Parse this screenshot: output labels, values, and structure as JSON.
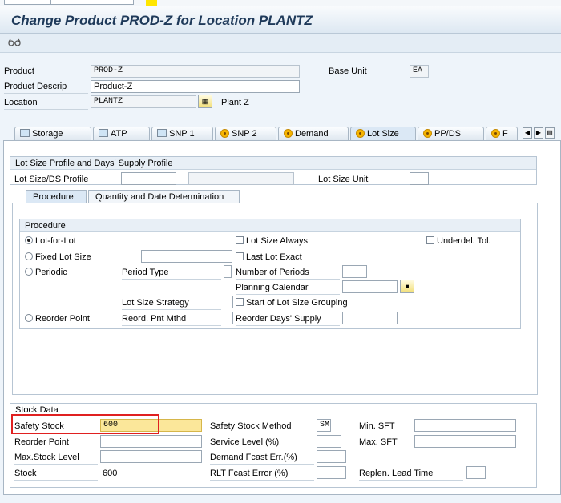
{
  "window": {
    "title": "Change Product PROD-Z for Location PLANTZ"
  },
  "toolbar": {
    "icon": "glasses-icon"
  },
  "header": {
    "product_label": "Product",
    "product_value": "PROD-Z",
    "descrip_label": "Product Descrip",
    "descrip_value": "Product-Z",
    "location_label": "Location",
    "location_value": "PLANTZ",
    "location_name": "Plant Z",
    "base_unit_label": "Base Unit",
    "base_unit_value": "EA"
  },
  "tabs": [
    {
      "label": "Storage"
    },
    {
      "label": "ATP"
    },
    {
      "label": "SNP 1"
    },
    {
      "label": "SNP 2"
    },
    {
      "label": "Demand"
    },
    {
      "label": "Lot Size"
    },
    {
      "label": "PP/DS"
    },
    {
      "label": "F"
    }
  ],
  "lot_profile": {
    "heading": "Lot Size Profile and Days' Supply Profile",
    "profile_label": "Lot Size/DS Profile",
    "profile_value": "",
    "profile_desc": "",
    "unit_label": "Lot Size Unit",
    "unit_value": ""
  },
  "subtabs": [
    {
      "label": "Procedure"
    },
    {
      "label": "Quantity and Date Determination"
    }
  ],
  "procedure": {
    "heading": "Procedure",
    "lot_for_lot": "Lot-for-Lot",
    "fixed_lot_size": "Fixed Lot Size",
    "periodic": "Periodic",
    "reorder_point": "Reorder Point",
    "period_type": "Period Type",
    "lot_size_strategy": "Lot Size Strategy",
    "reord_pnt_mthd": "Reord. Pnt Mthd",
    "lot_size_always": "Lot Size Always",
    "last_lot_exact": "Last Lot Exact",
    "number_of_periods": "Number of Periods",
    "planning_calendar": "Planning Calendar",
    "start_of_lot_size_grouping": "Start of Lot Size Grouping",
    "reorder_days_supply": "Reorder Days' Supply",
    "underdel_tol": "Underdel. Tol."
  },
  "stock": {
    "heading": "Stock Data",
    "safety_stock_label": "Safety Stock",
    "safety_stock_value": "600",
    "reorder_point_label": "Reorder Point",
    "max_stock_label": "Max.Stock Level",
    "stock_label": "Stock",
    "stock_value": "600",
    "ss_method_label": "Safety Stock Method",
    "ss_method_value": "SM",
    "service_level_label": "Service Level (%)",
    "demand_fcast_label": "Demand Fcast Err.(%)",
    "rlt_fcast_label": "RLT Fcast Error (%)",
    "min_sft_label": "Min. SFT",
    "max_sft_label": "Max. SFT",
    "replen_label": "Replen. Lead Time"
  }
}
